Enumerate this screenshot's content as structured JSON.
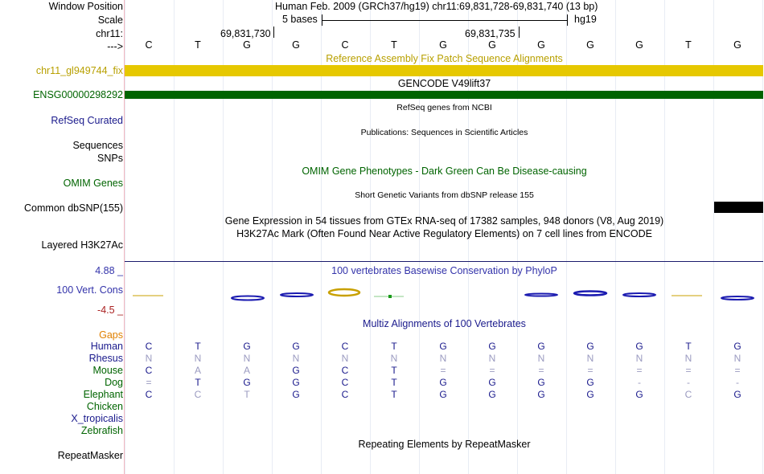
{
  "header": {
    "window_position_label": "Window Position",
    "window_position_value": "Human Feb. 2009 (GRCh37/hg19)   chr11:69,831,728-69,831,740 (13 bp)",
    "scale_label": "Scale",
    "scale_value": "5 bases",
    "scale_db": "hg19",
    "chrom_label": "chr11:",
    "coord1": "69,831,730",
    "coord2": "69,831,735",
    "strand_label": "--->"
  },
  "sequence_bases": [
    "C",
    "T",
    "G",
    "G",
    "C",
    "T",
    "G",
    "G",
    "G",
    "G",
    "G",
    "T",
    "G"
  ],
  "tracks": {
    "fix_patch": {
      "title": "Reference Assembly Fix Patch Sequence Alignments",
      "left_label": "chr11_gl949744_fix",
      "color": "#e6c800"
    },
    "gencode": {
      "title": "GENCODE V49lift37",
      "left_label": "ENSG00000298292",
      "color": "#006400"
    },
    "refseq": {
      "title": "RefSeq genes from NCBI",
      "left_label": "RefSeq Curated"
    },
    "publications": {
      "title": "Publications: Sequences in Scientific Articles",
      "left_label": "Sequences"
    },
    "snps": {
      "left_label": "SNPs"
    },
    "omim": {
      "title": "OMIM Gene Phenotypes - Dark Green Can Be Disease-causing",
      "left_label": "OMIM Genes"
    },
    "dbsnp": {
      "title": "Short Genetic Variants from dbSNP release 155",
      "left_label": "Common dbSNP(155)"
    },
    "gtex": {
      "title": "Gene Expression in 54 tissues from GTEx RNA-seq of 17382 samples, 948 donors (V8, Aug 2019)"
    },
    "h3k27ac": {
      "title": "H3K27Ac Mark (Often Found Near Active Regulatory Elements) on 7 cell lines from ENCODE",
      "left_label": "Layered H3K27Ac"
    },
    "phylop": {
      "title": "100 vertebrates Basewise Conservation by PhyloP",
      "left_label": "100 Vert. Cons",
      "max_label": "4.88 _",
      "min_label": "-4.5 _"
    },
    "multiz": {
      "title": "Multiz Alignments of 100 Vertebrates",
      "gaps_label": "Gaps"
    },
    "repeatmasker": {
      "title": "Repeating Elements by RepeatMasker",
      "left_label": "RepeatMasker"
    }
  },
  "species": [
    {
      "name": "Human",
      "bases": [
        "C",
        "T",
        "G",
        "G",
        "C",
        "T",
        "G",
        "G",
        "G",
        "G",
        "G",
        "T",
        "G"
      ]
    },
    {
      "name": "Rhesus",
      "bases": [
        "N",
        "N",
        "N",
        "N",
        "N",
        "N",
        "N",
        "N",
        "N",
        "N",
        "N",
        "N",
        "N"
      ]
    },
    {
      "name": "Mouse",
      "bases": [
        "C",
        "A",
        "A",
        "G",
        "C",
        "T",
        "=",
        "=",
        "=",
        "=",
        "=",
        "=",
        "="
      ]
    },
    {
      "name": "Dog",
      "bases": [
        "=",
        "T",
        "G",
        "G",
        "C",
        "T",
        "G",
        "G",
        "G",
        "G",
        "-",
        "-",
        "-"
      ]
    },
    {
      "name": "Elephant",
      "bases": [
        "C",
        "C",
        "T",
        "G",
        "C",
        "T",
        "G",
        "G",
        "G",
        "G",
        "G",
        "C",
        "G"
      ]
    },
    {
      "name": "Chicken",
      "bases": []
    },
    {
      "name": "X_tropicalis",
      "bases": []
    },
    {
      "name": "Zebrafish",
      "bases": []
    }
  ],
  "colors": {
    "label_blue": "#1a1a8c",
    "omim_green": "#006400",
    "fix_yellow": "#b8a000",
    "gaps_orange": "#e08000",
    "species_green": "#006400",
    "phylop_blue": "#3333aa",
    "phylop_red": "#aa2222"
  }
}
